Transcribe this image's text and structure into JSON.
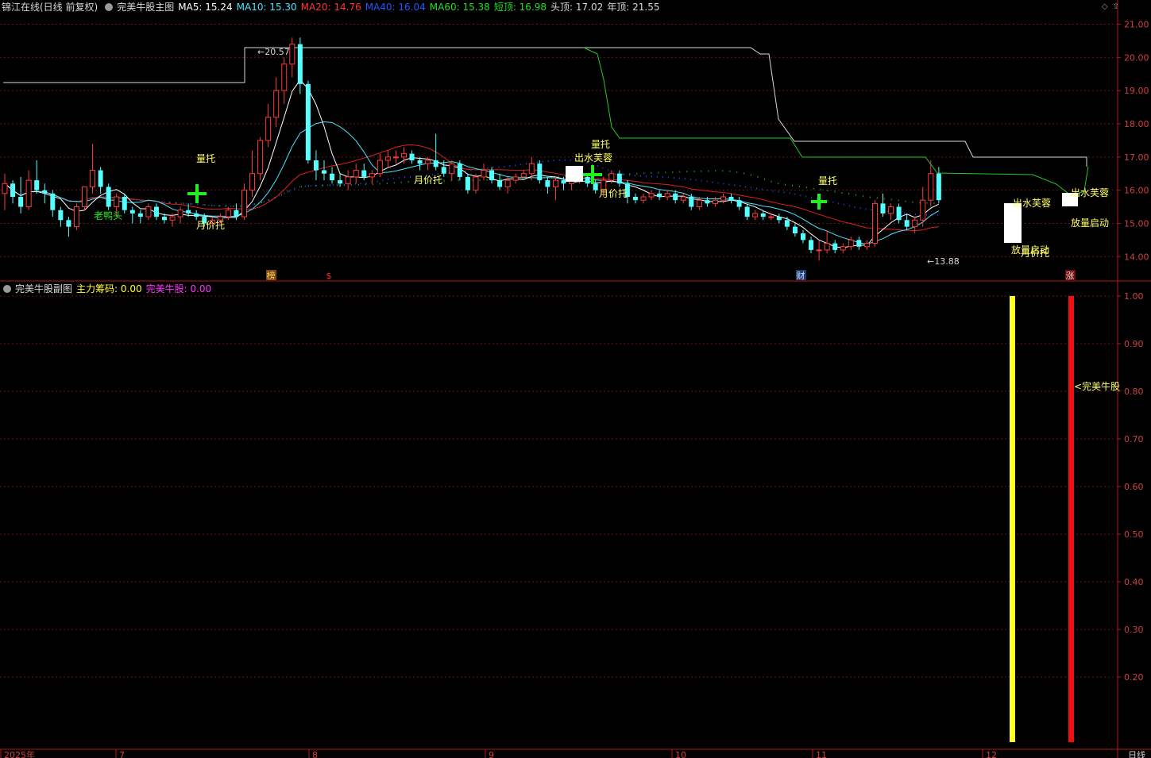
{
  "main_header": {
    "stock": "锦江在线(日线 前复权)",
    "indicator": "完美牛股主图",
    "items": [
      {
        "label": "MA5:",
        "value": "15.24",
        "color": "#ffffff"
      },
      {
        "label": "MA10:",
        "value": "15.30",
        "color": "#44e8ff"
      },
      {
        "label": "MA20:",
        "value": "14.76",
        "color": "#ff3333"
      },
      {
        "label": "MA40:",
        "value": "16.04",
        "color": "#2255ff"
      },
      {
        "label": "MA60:",
        "value": "15.38",
        "color": "#22dd22"
      },
      {
        "label": "短顶:",
        "value": "16.98",
        "color": "#22dd22"
      },
      {
        "label": "头顶:",
        "value": "17.02",
        "color": "#d8d8d8"
      },
      {
        "label": "年顶:",
        "value": "21.55",
        "color": "#d8d8d8"
      }
    ]
  },
  "sub_header": {
    "indicator": "完美牛股副图",
    "items": [
      {
        "label": "主力筹码:",
        "value": "0.00",
        "color": "#ffff33"
      },
      {
        "label": "完美牛股:",
        "value": "0.00",
        "color": "#ff33ff"
      }
    ]
  },
  "corner_icons": [
    "diamond-icon",
    "up-arrow-icon"
  ],
  "main_axis": {
    "ticks": [
      "21.00",
      "20.00",
      "19.00",
      "18.00",
      "17.00",
      "16.00",
      "15.00",
      "14.00"
    ]
  },
  "sub_axis": {
    "ticks": [
      "1.00",
      "0.90",
      "0.80",
      "0.70",
      "0.60",
      "0.50",
      "0.40",
      "0.30",
      "0.20"
    ]
  },
  "time_axis": {
    "ticks": [
      "2025年",
      "7",
      "8",
      "9",
      "10",
      "11",
      "12"
    ],
    "period": "日线"
  },
  "price_marks": {
    "high": "20.57",
    "low": "13.88"
  },
  "event_tags": [
    {
      "text": "榜",
      "bg": "#7a4a10",
      "fg": "#ffcc66"
    },
    {
      "text": "$",
      "bg": "#000000",
      "fg": "#ff3333"
    },
    {
      "text": "财",
      "bg": "#1e3a70",
      "fg": "#cce0ff"
    },
    {
      "text": "涨",
      "bg": "#6a1010",
      "fg": "#ffcccc"
    }
  ],
  "signals": [
    {
      "text": "老鸭头",
      "color": "#22ee22"
    },
    {
      "text": "量托",
      "color": "#ffff66"
    },
    {
      "text": "月价托",
      "color": "#ffff66"
    },
    {
      "text": "月价托",
      "color": "#ffff66"
    },
    {
      "text": "量托",
      "color": "#ffff66"
    },
    {
      "text": "出水芙蓉",
      "color": "#ffff66"
    },
    {
      "text": "月价托",
      "color": "#ffff66"
    },
    {
      "text": "量托",
      "color": "#ffff66"
    },
    {
      "text": "出水芙蓉",
      "color": "#ffff66"
    },
    {
      "text": "放量启动",
      "color": "#ffff66"
    },
    {
      "text": "月价托",
      "color": "#ffff66"
    },
    {
      "text": "出水芙蓉",
      "color": "#ffff66"
    },
    {
      "text": "放量启动",
      "color": "#ffff66"
    }
  ],
  "sub_signal_label": "完美牛股",
  "chart_data": {
    "type": "candlestick",
    "candles": [
      [
        15.9,
        16.5,
        15.4,
        16.2
      ],
      [
        16.2,
        16.3,
        15.6,
        15.8
      ],
      [
        15.8,
        16.4,
        15.3,
        15.5
      ],
      [
        15.5,
        16.6,
        15.4,
        16.3
      ],
      [
        16.3,
        16.9,
        15.9,
        16.0
      ],
      [
        16.0,
        16.2,
        15.6,
        15.9
      ],
      [
        15.9,
        16.0,
        15.2,
        15.4
      ],
      [
        15.4,
        15.5,
        14.9,
        15.1
      ],
      [
        15.1,
        15.2,
        14.6,
        14.9
      ],
      [
        14.9,
        15.6,
        14.8,
        15.5
      ],
      [
        15.5,
        16.1,
        15.4,
        16.1
      ],
      [
        16.1,
        17.4,
        15.9,
        16.6
      ],
      [
        16.6,
        16.7,
        15.9,
        16.1
      ],
      [
        16.1,
        16.2,
        15.4,
        15.5
      ],
      [
        15.5,
        15.9,
        15.2,
        15.8
      ],
      [
        15.8,
        15.9,
        15.3,
        15.4
      ],
      [
        15.4,
        15.5,
        15.0,
        15.3
      ],
      [
        15.3,
        15.4,
        15.0,
        15.2
      ],
      [
        15.2,
        15.6,
        15.1,
        15.5
      ],
      [
        15.5,
        15.6,
        15.1,
        15.2
      ],
      [
        15.2,
        15.3,
        15.0,
        15.1
      ],
      [
        15.1,
        15.3,
        14.9,
        15.2
      ],
      [
        15.2,
        15.5,
        15.0,
        15.4
      ],
      [
        15.4,
        15.6,
        15.2,
        15.3
      ],
      [
        15.3,
        15.4,
        15.1,
        15.2
      ],
      [
        15.2,
        15.3,
        14.9,
        15.0
      ],
      [
        15.0,
        15.2,
        14.9,
        15.1
      ],
      [
        15.1,
        15.3,
        15.0,
        15.2
      ],
      [
        15.2,
        15.5,
        15.1,
        15.4
      ],
      [
        15.4,
        15.6,
        15.1,
        15.2
      ],
      [
        15.2,
        16.2,
        15.1,
        16.0
      ],
      [
        16.0,
        17.2,
        15.8,
        16.5
      ],
      [
        16.5,
        17.6,
        16.3,
        17.5
      ],
      [
        17.5,
        18.6,
        17.3,
        18.2
      ],
      [
        18.2,
        19.4,
        17.9,
        19.0
      ],
      [
        19.0,
        20.0,
        18.6,
        19.8
      ],
      [
        19.8,
        20.6,
        19.4,
        20.4
      ],
      [
        20.4,
        20.6,
        18.9,
        19.2
      ],
      [
        19.2,
        19.3,
        16.8,
        16.9
      ],
      [
        16.9,
        17.2,
        16.3,
        16.6
      ],
      [
        16.6,
        16.9,
        16.3,
        16.5
      ],
      [
        16.5,
        16.7,
        16.2,
        16.3
      ],
      [
        16.3,
        16.5,
        16.1,
        16.2
      ],
      [
        16.2,
        16.6,
        16.0,
        16.4
      ],
      [
        16.4,
        16.8,
        16.2,
        16.6
      ],
      [
        16.6,
        16.8,
        16.3,
        16.4
      ],
      [
        16.4,
        16.6,
        16.2,
        16.5
      ],
      [
        16.5,
        17.1,
        16.4,
        16.9
      ],
      [
        16.9,
        17.2,
        16.7,
        17.0
      ],
      [
        17.0,
        17.2,
        16.8,
        17.0
      ],
      [
        17.0,
        17.3,
        16.8,
        17.1
      ],
      [
        17.1,
        17.2,
        16.8,
        16.9
      ],
      [
        16.9,
        17.0,
        16.6,
        16.8
      ],
      [
        16.8,
        17.0,
        16.6,
        16.9
      ],
      [
        16.9,
        17.7,
        16.6,
        16.7
      ],
      [
        16.7,
        16.9,
        16.4,
        16.5
      ],
      [
        16.5,
        16.9,
        16.3,
        16.8
      ],
      [
        16.8,
        16.9,
        16.3,
        16.4
      ],
      [
        16.4,
        16.5,
        15.9,
        16.0
      ],
      [
        16.0,
        16.5,
        15.9,
        16.4
      ],
      [
        16.4,
        16.8,
        16.3,
        16.6
      ],
      [
        16.6,
        16.7,
        16.2,
        16.3
      ],
      [
        16.3,
        16.5,
        16.0,
        16.1
      ],
      [
        16.1,
        16.4,
        15.9,
        16.3
      ],
      [
        16.3,
        16.5,
        16.2,
        16.4
      ],
      [
        16.4,
        16.6,
        16.4,
        16.5
      ],
      [
        16.5,
        17.0,
        16.3,
        16.8
      ],
      [
        16.8,
        16.9,
        16.2,
        16.3
      ],
      [
        16.3,
        16.4,
        15.9,
        16.1
      ],
      [
        16.1,
        16.4,
        15.7,
        16.3
      ],
      [
        16.3,
        16.4,
        16.0,
        16.2
      ],
      [
        16.2,
        16.4,
        16.0,
        16.3
      ],
      [
        16.3,
        16.6,
        16.2,
        16.4
      ],
      [
        16.4,
        16.5,
        16.1,
        16.2
      ],
      [
        16.2,
        16.3,
        15.9,
        16.0
      ],
      [
        16.0,
        16.4,
        15.8,
        16.3
      ],
      [
        16.3,
        16.6,
        16.2,
        16.5
      ],
      [
        16.5,
        16.6,
        16.1,
        16.2
      ],
      [
        16.2,
        16.3,
        15.6,
        15.8
      ],
      [
        15.8,
        15.9,
        15.6,
        15.7
      ],
      [
        15.7,
        15.9,
        15.6,
        15.8
      ],
      [
        15.8,
        16.0,
        15.7,
        15.9
      ],
      [
        15.9,
        16.0,
        15.7,
        15.8
      ],
      [
        15.8,
        16.0,
        15.7,
        15.9
      ],
      [
        15.9,
        16.0,
        15.6,
        15.7
      ],
      [
        15.7,
        15.9,
        15.6,
        15.8
      ],
      [
        15.8,
        15.9,
        15.4,
        15.5
      ],
      [
        15.5,
        15.8,
        15.4,
        15.7
      ],
      [
        15.7,
        15.8,
        15.5,
        15.6
      ],
      [
        15.6,
        15.8,
        15.5,
        15.7
      ],
      [
        15.7,
        15.9,
        15.6,
        15.8
      ],
      [
        15.8,
        15.9,
        15.6,
        15.7
      ],
      [
        15.7,
        15.8,
        15.4,
        15.5
      ],
      [
        15.5,
        15.6,
        15.1,
        15.2
      ],
      [
        15.2,
        15.4,
        15.1,
        15.3
      ],
      [
        15.3,
        15.4,
        15.1,
        15.2
      ],
      [
        15.2,
        15.3,
        15.1,
        15.2
      ],
      [
        15.2,
        15.3,
        15.0,
        15.1
      ],
      [
        15.1,
        15.2,
        14.8,
        14.9
      ],
      [
        14.9,
        15.0,
        14.6,
        14.7
      ],
      [
        14.7,
        14.8,
        14.4,
        14.5
      ],
      [
        14.5,
        14.6,
        14.1,
        14.2
      ],
      [
        14.2,
        14.5,
        13.88,
        14.2
      ],
      [
        14.2,
        14.8,
        14.1,
        14.4
      ],
      [
        14.4,
        14.5,
        14.1,
        14.2
      ],
      [
        14.2,
        14.4,
        14.1,
        14.3
      ],
      [
        14.3,
        14.6,
        14.2,
        14.5
      ],
      [
        14.5,
        14.6,
        14.2,
        14.3
      ],
      [
        14.3,
        14.5,
        14.2,
        14.4
      ],
      [
        14.4,
        15.7,
        14.3,
        15.6
      ],
      [
        15.6,
        15.9,
        15.2,
        15.3
      ],
      [
        15.3,
        15.6,
        15.1,
        15.5
      ],
      [
        15.5,
        15.6,
        15.0,
        15.1
      ],
      [
        15.1,
        15.3,
        14.8,
        14.9
      ],
      [
        14.9,
        15.2,
        14.7,
        15.1
      ],
      [
        15.1,
        16.1,
        14.9,
        15.7
      ],
      [
        15.7,
        16.9,
        15.5,
        16.5
      ],
      [
        16.5,
        16.7,
        15.6,
        15.7
      ]
    ],
    "ylim": [
      13.6,
      21.3
    ],
    "sub_values": {
      "主力筹码_bar": 1.0,
      "完美牛股_bar": 1.0
    }
  }
}
